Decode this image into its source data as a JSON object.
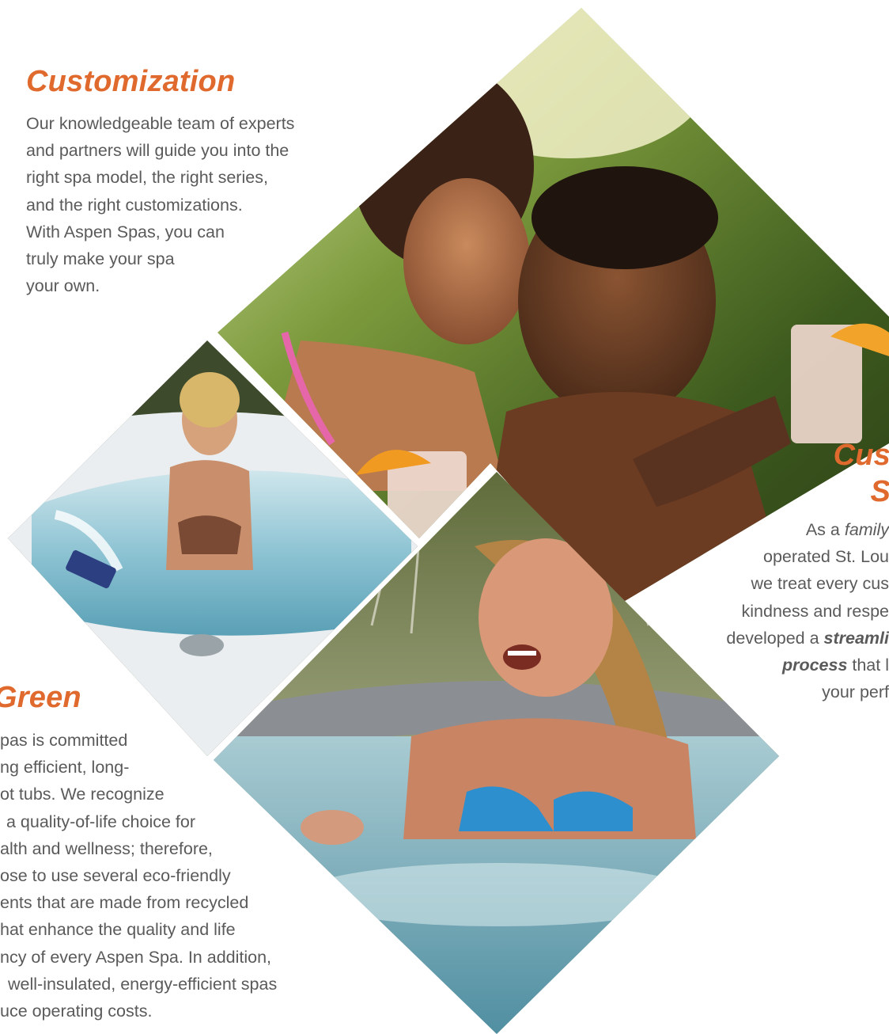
{
  "customization": {
    "title": "Customization",
    "lines": [
      "Our knowledgeable team of experts",
      "and partners will guide you into the",
      "right spa model, the right series,",
      "and the right customizations.",
      "With Aspen Spas, you can",
      "truly make your spa",
      "your own."
    ]
  },
  "green": {
    "title": "Green",
    "lines": [
      "pas is committed",
      "ng efficient, long-",
      "ot tubs. We recognize",
      "a quality-of-life choice for",
      "alth and wellness; therefore,",
      "ose to use several eco-friendly",
      "ents that are made from recycled",
      "hat enhance the quality and life",
      "ncy of every Aspen Spa. In addition,",
      "well-insulated, energy-efficient spas",
      "uce operating costs."
    ]
  },
  "service": {
    "title_line1": "Cus",
    "title_line2": "S",
    "line1_pre": "As a ",
    "line1_em": "family",
    "line2": "operated St. Lou",
    "line3": "we treat every cus",
    "line4": "kindness and respe",
    "line5_pre": "developed a ",
    "line5_strong": "streamli",
    "line6_strong": "process",
    "line6_post": " that l",
    "line7": "your perf"
  },
  "colors": {
    "accent": "#e06a2d",
    "body_text": "#5a5a5a",
    "background": "#ffffff"
  }
}
